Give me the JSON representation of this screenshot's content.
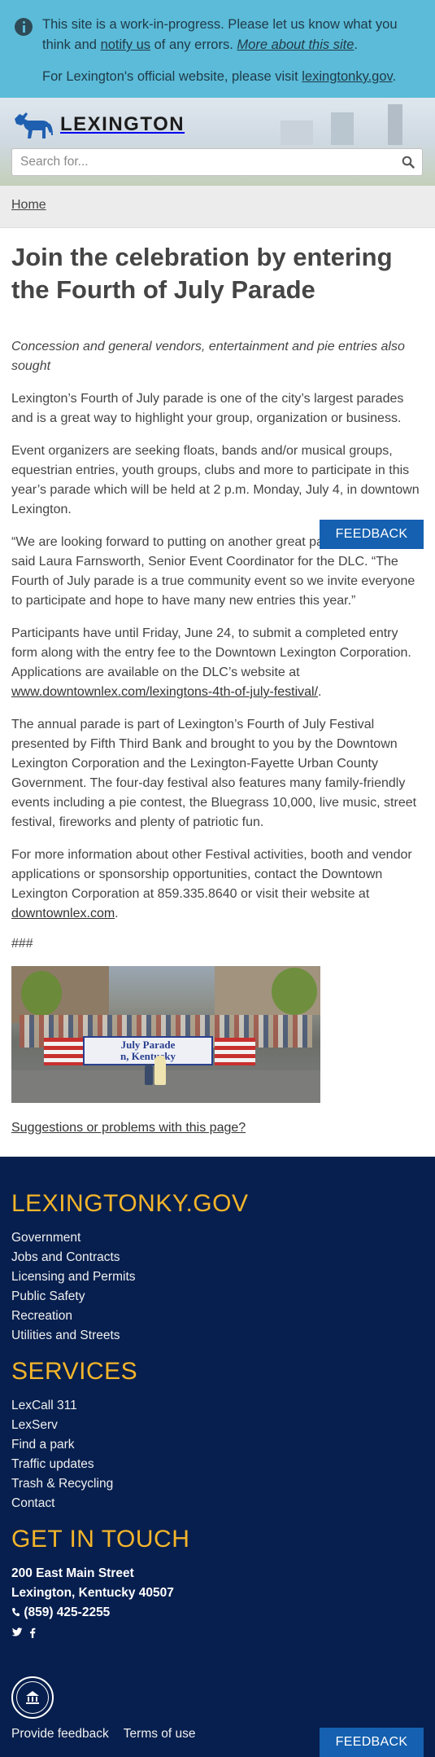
{
  "banner": {
    "text1": "This site is a work-in-progress. Please let us know what you think and",
    "notify_link": "notify us",
    "text2": "of any errors.",
    "about_link": "More about this site",
    "text3": ".",
    "official_text": "For Lexington's official website, please visit",
    "official_link": "lexingtonky.gov",
    "official_end": "."
  },
  "header": {
    "logo_text": "LEXINGTON",
    "search_placeholder": "Search for..."
  },
  "breadcrumb": {
    "home": "Home"
  },
  "article": {
    "title": "Join the celebration by entering the Fourth of July Parade",
    "subtitle": "Concession and general vendors, entertainment and pie entries also sought",
    "p1": "Lexington’s Fourth of July parade is one of the city’s largest parades and is a great way to highlight your group, organization or business.",
    "p2": "Event organizers are seeking floats, bands and/or musical groups, equestrian entries, youth groups, clubs and more to participate in this year’s parade which will be held at 2 p.m. Monday, July 4, in downtown Lexington.",
    "p3": "“We are looking forward to putting on another great parade this year,” said Laura Farnsworth, Senior Event Coordinator for the DLC. “The Fourth of July parade is a true community event so we invite everyone to participate and hope to have many new entries this year.”",
    "p4_text": "Participants have until Friday, June 24, to submit a completed entry form along with the entry fee to the Downtown Lexington Corporation. Applications are available on the DLC’s website at",
    "p4_link": "www.downtownlex.com/lexingtons-4th-of-july-festival/",
    "p4_end": ".",
    "p5": "The annual parade is part of Lexington’s Fourth of July Festival presented by Fifth Third Bank and brought to you by the Downtown Lexington Corporation and the Lexington-Fayette Urban County Government. The four-day festival also features many family-friendly events including a pie contest, the Bluegrass 10,000, live music, street festival, fireworks and plenty of patriotic fun.",
    "p6_text": "For more information about other Festival activities, booth and vendor applications or sponsorship opportunities, contact the Downtown Lexington Corporation at 859.335.8640 or visit their website at",
    "p6_link": "downtownlex.com",
    "p6_end": ".",
    "hashes": "###",
    "photo_banner_line1": "July Parade",
    "photo_banner_line2": "n, Kentucky",
    "suggest_link": "Suggestions or problems with this page?"
  },
  "feedback_label": "FEEDBACK",
  "footer": {
    "site_heading": "LEXINGTONKY.GOV",
    "site_links": [
      "Government",
      "Jobs and Contracts",
      "Licensing and Permits",
      "Public Safety",
      "Recreation",
      "Utilities and Streets"
    ],
    "services_heading": "SERVICES",
    "services_links": [
      "LexCall 311",
      "LexServ",
      "Find a park",
      "Traffic updates",
      "Trash & Recycling",
      "Contact"
    ],
    "contact_heading": "GET IN TOUCH",
    "address1": "200 East Main Street",
    "address2": "Lexington, Kentucky 40507",
    "phone": "(859) 425-2255",
    "provide_feedback": "Provide feedback",
    "terms": "Terms of use"
  },
  "colors": {
    "banner_bg": "#5bbbd8",
    "feedback_bg": "#1560b0",
    "footer_bg": "#071f4e",
    "footer_heading": "#f4b52a"
  },
  "icons": [
    "info-icon",
    "horse-logo-icon",
    "search-icon",
    "phone-icon",
    "twitter-icon",
    "facebook-icon",
    "city-seal-icon"
  ]
}
